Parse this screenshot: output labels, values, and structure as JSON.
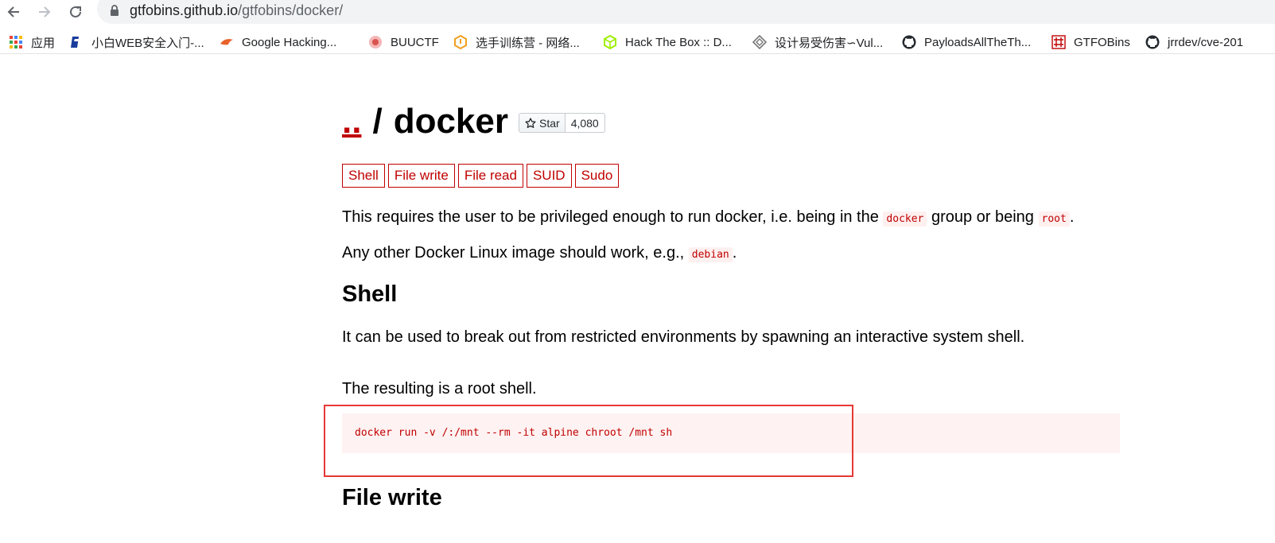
{
  "browser": {
    "url_host": "gtfobins.github.io",
    "url_path": "/gtfobins/docker/",
    "bookmarks": [
      {
        "label": "应用",
        "icon": "apps-grid-icon"
      },
      {
        "label": "小白WEB安全入门-...",
        "icon": "bilibili-icon"
      },
      {
        "label": "Google Hacking...",
        "icon": "bird-icon"
      },
      {
        "label": "BUUCTF",
        "icon": "buuctf-icon"
      },
      {
        "label": "选手训练营 - 网络...",
        "icon": "training-icon"
      },
      {
        "label": "Hack The Box :: D...",
        "icon": "htb-cube-icon"
      },
      {
        "label": "设计易受伤害∽Vul...",
        "icon": "vuln-icon"
      },
      {
        "label": "PayloadsAllTheTh...",
        "icon": "github-icon"
      },
      {
        "label": "GTFOBins",
        "icon": "gtfobins-icon"
      },
      {
        "label": "jrrdev/cve-201",
        "icon": "github-icon"
      }
    ]
  },
  "page": {
    "title_up": "..",
    "title_sep": "/",
    "title_name": "docker",
    "star_label": "Star",
    "star_count": "4,080",
    "tags": [
      "Shell",
      "File write",
      "File read",
      "SUID",
      "Sudo"
    ],
    "intro": {
      "p1_before": "This requires the user to be privileged enough to run docker, i.e. being in the ",
      "p1_code1": "docker",
      "p1_middle": " group or being ",
      "p1_code2": "root",
      "p1_after": ".",
      "p2_before": "Any other Docker Linux image should work, e.g., ",
      "p2_code": "debian",
      "p2_after": "."
    },
    "shell_section": {
      "heading": "Shell",
      "description": "It can be used to break out from restricted environments by spawning an interactive system shell.",
      "note": "The resulting is a root shell.",
      "code": "docker run -v /:/mnt --rm -it alpine chroot /mnt sh"
    },
    "file_write_section": {
      "heading": "File write"
    }
  },
  "colors": {
    "accent": "#c00000",
    "code_bg": "#fff2f2",
    "highlight_box": "#e53935"
  }
}
